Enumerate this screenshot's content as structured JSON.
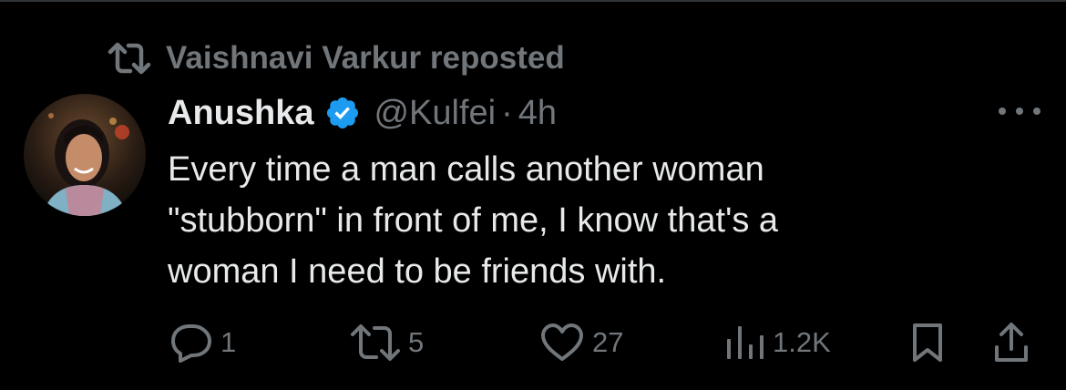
{
  "repost": {
    "text": "Vaishnavi Varkur reposted",
    "icon": "repost-icon"
  },
  "tweet": {
    "author": {
      "name": "Anushka",
      "verified": true,
      "handle": "@Kulfei",
      "dot": "·",
      "time": "4h"
    },
    "text": "Every time a man calls another woman\n\"stubborn\" in front of me, I know that's a\nwoman I need to be friends with.",
    "actions": {
      "replies": "1",
      "reposts": "5",
      "likes": "27",
      "views": "1.2K"
    }
  },
  "colors": {
    "background": "#000000",
    "text": "#e7e9ea",
    "secondary": "#71767b",
    "verified": "#1d9bf0"
  }
}
